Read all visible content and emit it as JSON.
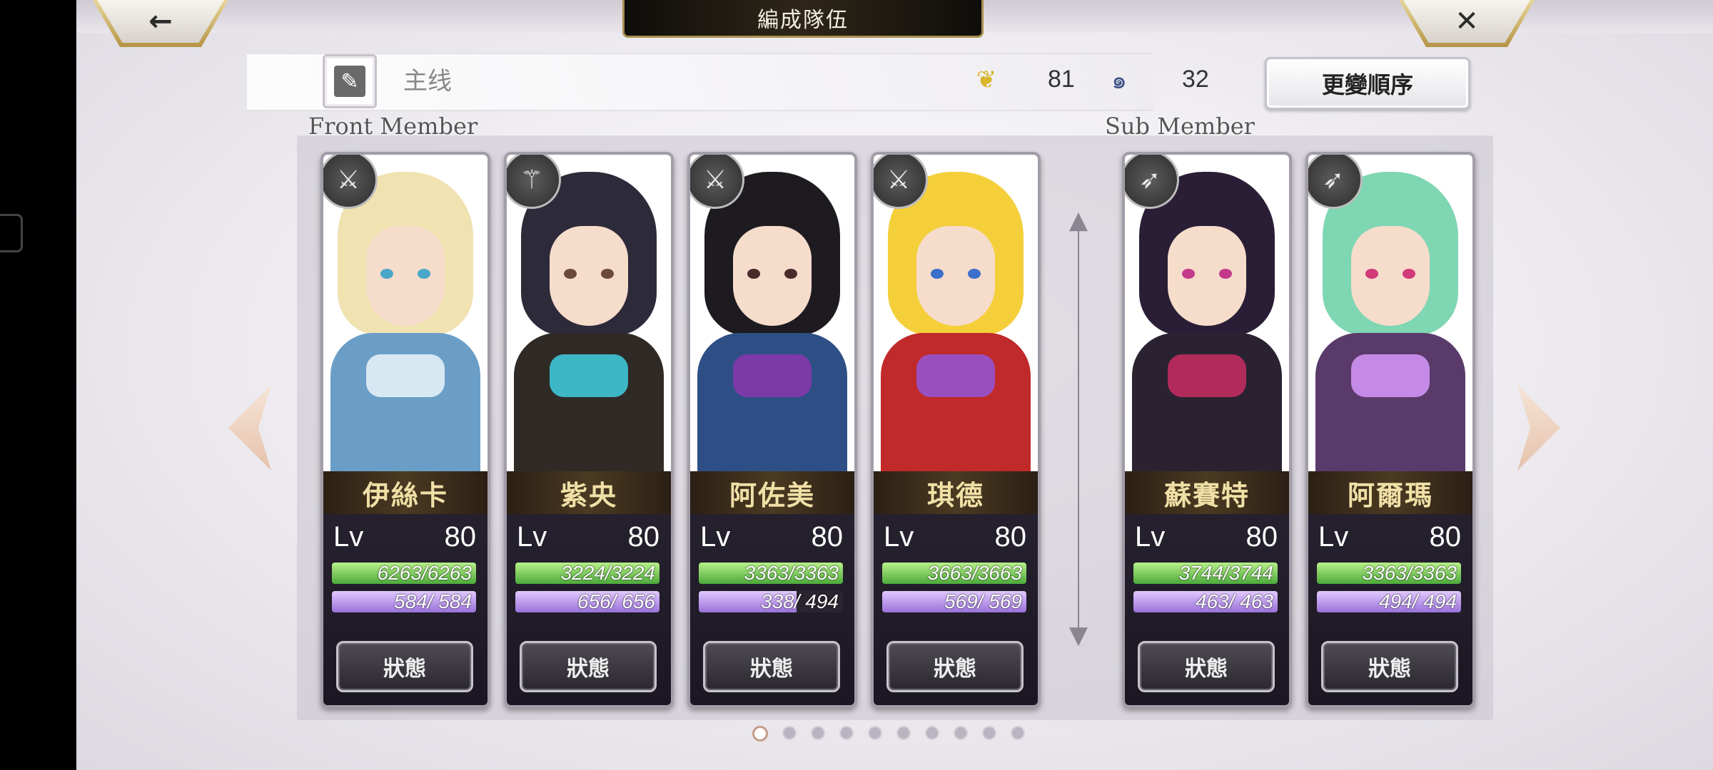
{
  "header": {
    "title": "編成隊伍",
    "back_icon": "←",
    "close_icon": "✕"
  },
  "party": {
    "name": "主线",
    "edit_icon": "✎",
    "wing_icon": "❦",
    "spiral_icon": "๑",
    "wing_value": "81",
    "spiral_value": "32",
    "order_button": "更變順序"
  },
  "labels": {
    "front": "Front Member",
    "sub": "Sub Member"
  },
  "weapon_icons": [
    "⚔",
    "⚚",
    "⚔",
    "⚔",
    "➶",
    "➶"
  ],
  "members": [
    {
      "name": "伊絲卡",
      "lv_label": "Lv",
      "lv": "80",
      "hp": "6263/6263",
      "hp_fill": 1.0,
      "sp": "584/ 584",
      "sp_fill": 1.0,
      "status": "狀態",
      "weapon": "sword",
      "colors": {
        "hair": "#f1e2b2",
        "body": "#6a9ec7",
        "accent": "#d8e8f2",
        "eye": "#4aa7c9"
      }
    },
    {
      "name": "紫央",
      "lv_label": "Lv",
      "lv": "80",
      "hp": "3224/3224",
      "hp_fill": 1.0,
      "sp": "656/ 656",
      "sp_fill": 1.0,
      "status": "狀態",
      "weapon": "staff",
      "colors": {
        "hair": "#2d2a3a",
        "body": "#2f2a26",
        "accent": "#3db6c6",
        "eye": "#6b4a3a"
      }
    },
    {
      "name": "阿佐美",
      "lv_label": "Lv",
      "lv": "80",
      "hp": "3363/3363",
      "hp_fill": 1.0,
      "sp": "338/ 494",
      "sp_fill": 0.68,
      "status": "狀態",
      "weapon": "sword",
      "colors": {
        "hair": "#1e1b20",
        "body": "#2e4f86",
        "accent": "#7b3aa8",
        "eye": "#4a2a2a"
      }
    },
    {
      "name": "琪德",
      "lv_label": "Lv",
      "lv": "80",
      "hp": "3663/3663",
      "hp_fill": 1.0,
      "sp": "569/ 569",
      "sp_fill": 1.0,
      "status": "狀態",
      "weapon": "sword",
      "colors": {
        "hair": "#f4cf3a",
        "body": "#c02a2a",
        "accent": "#9a4fc0",
        "eye": "#3b6fc9"
      }
    },
    {
      "name": "蘇賽特",
      "lv_label": "Lv",
      "lv": "80",
      "hp": "3744/3744",
      "hp_fill": 1.0,
      "sp": "463/ 463",
      "sp_fill": 1.0,
      "status": "狀態",
      "weapon": "spear",
      "colors": {
        "hair": "#2a1e36",
        "body": "#2a2230",
        "accent": "#b02a5a",
        "eye": "#c33a8a"
      }
    },
    {
      "name": "阿爾瑪",
      "lv_label": "Lv",
      "lv": "80",
      "hp": "3363/3363",
      "hp_fill": 1.0,
      "sp": "494/ 494",
      "sp_fill": 1.0,
      "status": "狀態",
      "weapon": "bow",
      "colors": {
        "hair": "#7fd6b2",
        "body": "#5a3a6a",
        "accent": "#c58ae6",
        "eye": "#d23a7a"
      }
    }
  ],
  "pager": {
    "total": 10,
    "active": 1
  }
}
